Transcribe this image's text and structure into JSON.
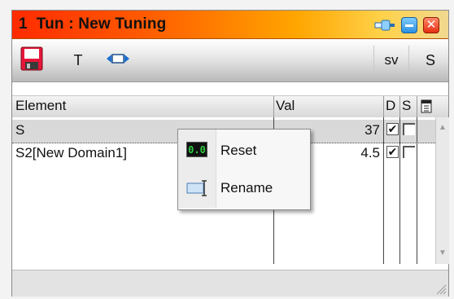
{
  "window": {
    "title": "1  Tun : New Tuning",
    "colors": {
      "title_gradient_start": "#ff2b00",
      "title_gradient_end": "#ffd24a"
    }
  },
  "toolbar": {
    "save_icon": "floppy-disk-icon",
    "text_tool_label": "T",
    "fit_icon": "resize-horizontal-icon",
    "sv_label": "sv",
    "s_label": "S"
  },
  "table": {
    "headers": {
      "element": "Element",
      "val": "Val",
      "d": "D",
      "s": "S"
    },
    "rows": [
      {
        "element": "S",
        "val": "37",
        "d": true,
        "s": false,
        "selected": true
      },
      {
        "element": "S2[New Domain1]",
        "val": "4.5",
        "d": true,
        "s": false,
        "selected": false
      }
    ]
  },
  "context_menu": {
    "items": [
      {
        "label": "Reset",
        "icon": "reset-display-icon",
        "icon_text": "0.0"
      },
      {
        "label": "Rename",
        "icon": "rename-icon"
      }
    ]
  }
}
